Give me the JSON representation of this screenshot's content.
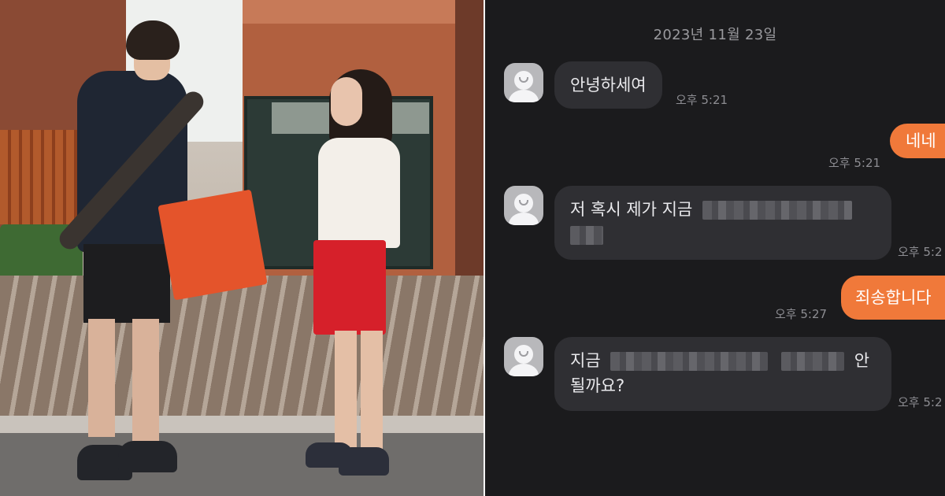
{
  "chat": {
    "date": "2023년 11월 23일",
    "messages": [
      {
        "direction": "in",
        "text": "안녕하세여",
        "time": "오후 5:21"
      },
      {
        "direction": "out",
        "text": "네네",
        "time": "오후 5:21"
      },
      {
        "direction": "in",
        "text_start": "저 혹시 제가 지금",
        "text_end": "",
        "time": "오후 5:2"
      },
      {
        "direction": "out",
        "text": "죄송합니다",
        "time": "오후 5:27"
      },
      {
        "direction": "in",
        "text_start": "지금",
        "text_mid": "안",
        "text_end": "될까요?",
        "time": "오후 5:2"
      }
    ]
  },
  "colors": {
    "chat_background": "#1b1b1d",
    "incoming_bubble": "#2f2f33",
    "outgoing_bubble": "#f0793a",
    "timestamp_text": "#8d8d92"
  },
  "icons": {
    "avatar": "default-profile-icon"
  }
}
